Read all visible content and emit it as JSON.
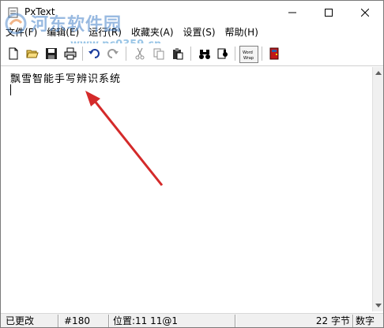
{
  "window": {
    "title": "PxText"
  },
  "watermark": {
    "text": "河东软件园",
    "url": "www.pc0359.cn"
  },
  "menu": {
    "items": [
      {
        "label": "文件(F)"
      },
      {
        "label": "编辑(E)"
      },
      {
        "label": "运行(R)"
      },
      {
        "label": "收藏夹(A)"
      },
      {
        "label": "设置(S)"
      },
      {
        "label": "帮助(H)"
      }
    ]
  },
  "toolbar": {
    "buttons": [
      {
        "icon": "new-file-icon"
      },
      {
        "icon": "open-folder-icon"
      },
      {
        "icon": "save-disk-icon"
      },
      {
        "icon": "print-icon"
      },
      {
        "icon": "undo-icon"
      },
      {
        "icon": "redo-icon"
      },
      {
        "icon": "cut-icon"
      },
      {
        "icon": "copy-icon"
      },
      {
        "icon": "paste-icon"
      },
      {
        "icon": "find-binoculars-icon"
      },
      {
        "icon": "replace-icon"
      },
      {
        "icon": "word-wrap-icon"
      },
      {
        "icon": "exit-door-icon"
      }
    ],
    "word_wrap_label": "Word Wrap"
  },
  "editor": {
    "text": "飘雪智能手写辨识系统"
  },
  "status": {
    "modified": "已更改",
    "char_code": "#180",
    "position": "位置:11  11@1",
    "byte_count": "22 字节",
    "mode": "数字"
  },
  "colors": {
    "arrow": "#d42a2a",
    "watermark": "#4682c8"
  }
}
